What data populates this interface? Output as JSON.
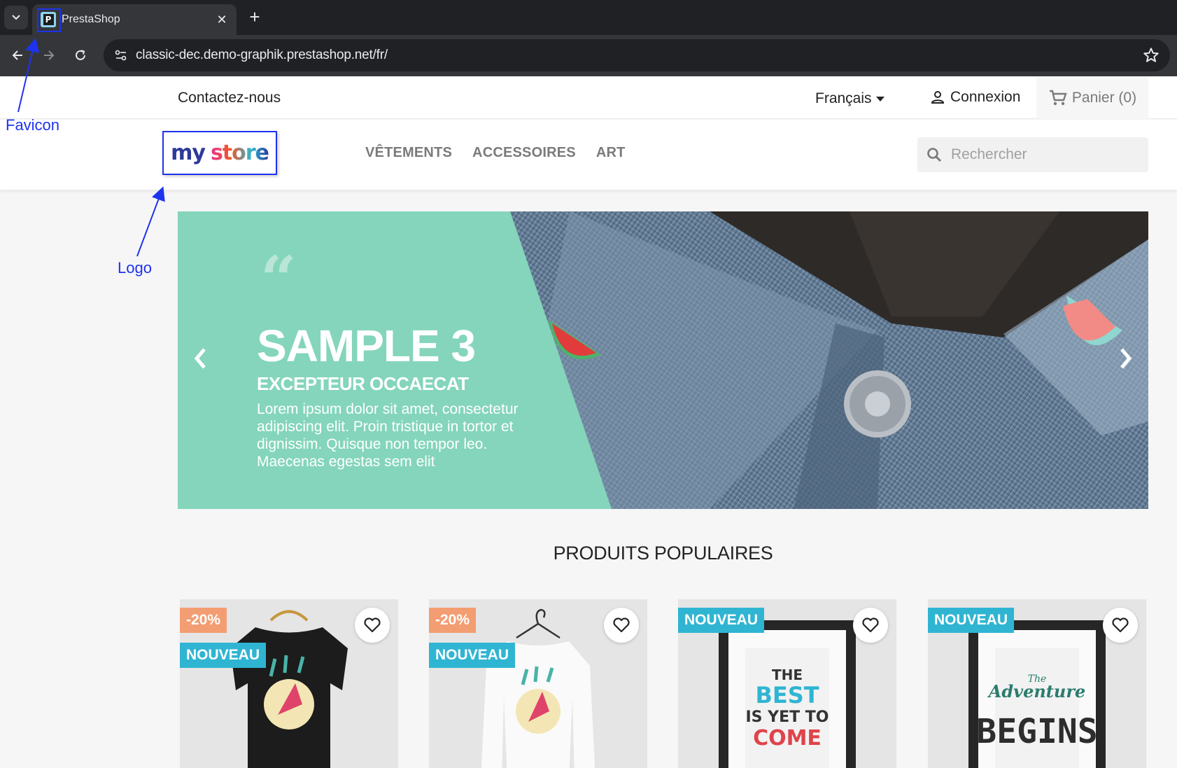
{
  "browser": {
    "tab_title": "PrestaShop",
    "favicon_letter": "P",
    "url": "classic-dec.demo-graphik.prestashop.net/fr/"
  },
  "header": {
    "contact": "Contactez-nous",
    "language": "Français",
    "login": "Connexion",
    "cart": "Panier (0)"
  },
  "logo": {
    "part1": "my",
    "part2": "store"
  },
  "menu": [
    "VÊTEMENTS",
    "ACCESSOIRES",
    "ART"
  ],
  "search": {
    "placeholder": "Rechercher"
  },
  "annotations": {
    "favicon": "Favicon",
    "logo": "Logo",
    "color": "#1e33ee"
  },
  "hero": {
    "quote": "“",
    "title": "SAMPLE 3",
    "subtitle": "EXCEPTEUR OCCAECAT",
    "text": "Lorem ipsum dolor sit amet, consectetur adipiscing elit. Proin tristique in tortor et dignissim. Quisque non tempor leo. Maecenas egestas sem elit",
    "accent_color": "#84d5bb"
  },
  "section": {
    "title": "PRODUITS POPULAIRES"
  },
  "products": [
    {
      "discount": "-20%",
      "new": "NOUVEAU",
      "image": "black-tshirt-hummingbird"
    },
    {
      "discount": "-20%",
      "new": "NOUVEAU",
      "image": "white-sweater-hummingbird"
    },
    {
      "new": "NOUVEAU",
      "image": "poster-the-best-is-yet-to-come"
    },
    {
      "new": "NOUVEAU",
      "image": "poster-the-adventure-begins"
    }
  ],
  "colors": {
    "badge_discount": "#f39d72",
    "badge_new": "#2fb5d2"
  }
}
